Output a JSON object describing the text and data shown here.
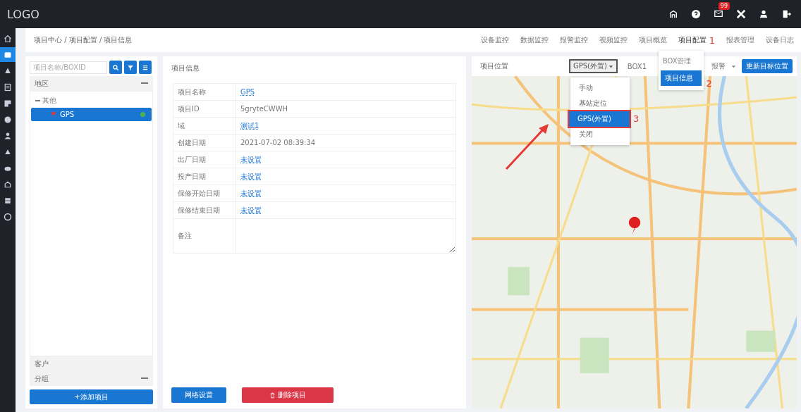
{
  "header": {
    "logo": "LOGO",
    "badge": "99"
  },
  "rail": [
    {
      "selected": false
    },
    {
      "selected": true
    },
    {
      "selected": false
    },
    {
      "selected": false
    },
    {
      "selected": false
    },
    {
      "selected": false
    },
    {
      "selected": false
    },
    {
      "selected": false
    },
    {
      "selected": false
    },
    {
      "selected": false
    },
    {
      "selected": false
    },
    {
      "selected": false
    }
  ],
  "breadcrumb": "项目中心 / 项目配置 / 项目信息",
  "nav": [
    {
      "label": "设备监控",
      "selected": false
    },
    {
      "label": "数据监控",
      "selected": false
    },
    {
      "label": "报警监控",
      "selected": false
    },
    {
      "label": "视频监控",
      "selected": false
    },
    {
      "label": "项目概览",
      "selected": false
    },
    {
      "label": "项目配置",
      "selected": true,
      "annotation": "1"
    },
    {
      "label": "报表管理",
      "selected": false
    },
    {
      "label": "设备日志",
      "selected": false
    }
  ],
  "nav_menu": {
    "annotation": "2",
    "items": [
      {
        "label": "BOX管理",
        "selected": false
      },
      {
        "label": "项目信息",
        "selected": true
      }
    ]
  },
  "tree_panel": {
    "search": {
      "placeholder": "项目名称/BOXID"
    },
    "sections": [
      {
        "label": "地区",
        "expanded": true,
        "children": [
          {
            "label": "其他",
            "expanded": true,
            "children": [
              {
                "label": "GPS",
                "selected": true,
                "online": true
              }
            ]
          }
        ]
      },
      {
        "label": "客户",
        "expanded": false
      },
      {
        "label": "分组",
        "expanded": true
      }
    ],
    "add_button": "+添加项目"
  },
  "detail_panel": {
    "title": "项目信息",
    "rows": [
      {
        "label": "项目名称",
        "value": "GPS",
        "kind": "link"
      },
      {
        "label": "项目ID",
        "value": "5gryteCWWH",
        "kind": "text"
      },
      {
        "label": "域",
        "value": "测试1",
        "kind": "link"
      },
      {
        "label": "创建日期",
        "value": "2021-07-02 08:39:34",
        "kind": "text"
      },
      {
        "label": "出厂日期",
        "value": "未设置",
        "kind": "link"
      },
      {
        "label": "投产日期",
        "value": "未设置",
        "kind": "link"
      },
      {
        "label": "保修开始日期",
        "value": "未设置",
        "kind": "link"
      },
      {
        "label": "保修结束日期",
        "value": "未设置",
        "kind": "link"
      },
      {
        "label": "备注",
        "value": "",
        "kind": "textarea"
      }
    ],
    "buttons": [
      {
        "label": "网络设置",
        "kind": "primary"
      },
      {
        "label": "删除项目",
        "kind": "danger"
      }
    ]
  },
  "map_panel": {
    "title": "项目位置",
    "location_select": {
      "value": "GPS(外置)",
      "annotation": "3",
      "options": [
        {
          "label": "手动",
          "selected": false
        },
        {
          "label": "基站定位",
          "selected": false
        },
        {
          "label": "GPS(外置)",
          "selected": true
        },
        {
          "label": "关闭",
          "selected": false
        }
      ]
    },
    "box": "BOX1",
    "alarm": "报警",
    "update_button": "更新目标位置"
  }
}
